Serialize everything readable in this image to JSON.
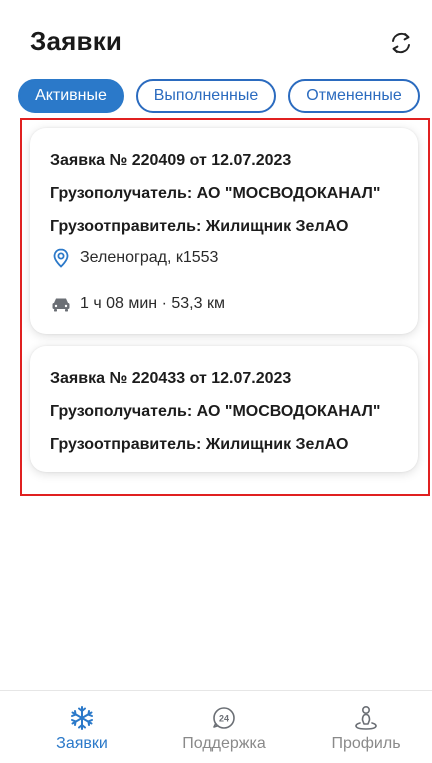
{
  "header": {
    "title": "Заявки",
    "refresh_icon": "refresh-icon"
  },
  "tabs": [
    {
      "label": "Активные",
      "active": true
    },
    {
      "label": "Выполненные",
      "active": false
    },
    {
      "label": "Отмененные",
      "active": false
    }
  ],
  "cards": [
    {
      "title": "Заявка № 220409 от 12.07.2023",
      "consignee": "Грузополучатель: АО \"МОСВОДОКАНАЛ\"",
      "shipper": "Грузоотправитель: Жилищник ЗелАО",
      "location": "Зеленоград, к1553",
      "route": "1 ч 08 мин · 53,3 км"
    },
    {
      "title": "Заявка № 220433 от 12.07.2023",
      "consignee": "Грузополучатель: АО \"МОСВОДОКАНАЛ\"",
      "shipper": "Грузоотправитель: Жилищник ЗелАО"
    }
  ],
  "bottom_nav": [
    {
      "label": "Заявки",
      "icon": "snowflake-icon",
      "active": true
    },
    {
      "label": "Поддержка",
      "icon": "support-24-icon",
      "active": false
    },
    {
      "label": "Профиль",
      "icon": "profile-pin-icon",
      "active": false
    }
  ],
  "colors": {
    "accent": "#2b79c9",
    "highlight_frame": "#e02020",
    "inactive_nav": "#8a8a8a"
  }
}
